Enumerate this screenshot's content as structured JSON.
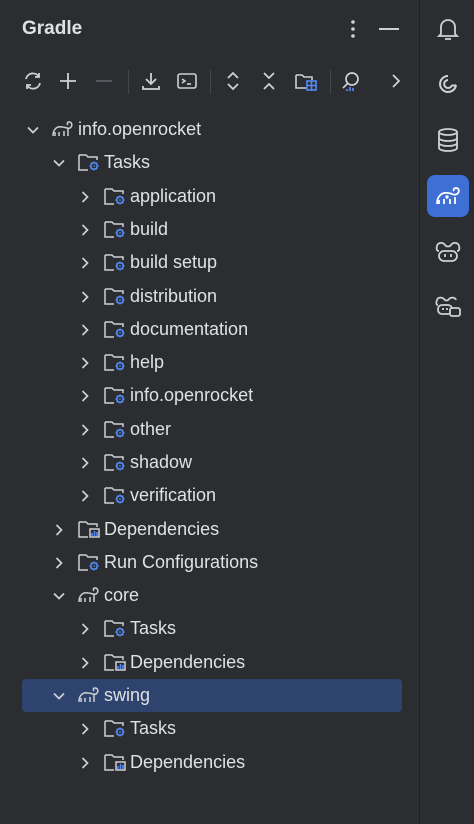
{
  "header": {
    "title": "Gradle"
  },
  "tree": [
    {
      "label": "info.openrocket",
      "icon": "gradle-elephant-icon",
      "expanded": true,
      "level": 0
    },
    {
      "label": "Tasks",
      "icon": "folder-gear-icon",
      "expanded": true,
      "level": 1
    },
    {
      "label": "application",
      "icon": "folder-gear-icon",
      "expanded": false,
      "level": 2
    },
    {
      "label": "build",
      "icon": "folder-gear-icon",
      "expanded": false,
      "level": 2
    },
    {
      "label": "build setup",
      "icon": "folder-gear-icon",
      "expanded": false,
      "level": 2
    },
    {
      "label": "distribution",
      "icon": "folder-gear-icon",
      "expanded": false,
      "level": 2
    },
    {
      "label": "documentation",
      "icon": "folder-gear-icon",
      "expanded": false,
      "level": 2
    },
    {
      "label": "help",
      "icon": "folder-gear-icon",
      "expanded": false,
      "level": 2
    },
    {
      "label": "info.openrocket",
      "icon": "folder-gear-icon",
      "expanded": false,
      "level": 2
    },
    {
      "label": "other",
      "icon": "folder-gear-icon",
      "expanded": false,
      "level": 2
    },
    {
      "label": "shadow",
      "icon": "folder-gear-icon",
      "expanded": false,
      "level": 2
    },
    {
      "label": "verification",
      "icon": "folder-gear-icon",
      "expanded": false,
      "level": 2
    },
    {
      "label": "Dependencies",
      "icon": "folder-chart-icon",
      "expanded": false,
      "level": 1
    },
    {
      "label": "Run Configurations",
      "icon": "folder-gear-icon",
      "expanded": false,
      "level": 1
    },
    {
      "label": "core",
      "icon": "gradle-elephant-icon",
      "expanded": true,
      "level": 1
    },
    {
      "label": "Tasks",
      "icon": "folder-gear-icon",
      "expanded": false,
      "level": 2
    },
    {
      "label": "Dependencies",
      "icon": "folder-chart-icon",
      "expanded": false,
      "level": 2
    },
    {
      "label": "swing",
      "icon": "gradle-elephant-icon",
      "expanded": true,
      "level": 1,
      "selected": true
    },
    {
      "label": "Tasks",
      "icon": "folder-gear-icon",
      "expanded": false,
      "level": 2
    },
    {
      "label": "Dependencies",
      "icon": "folder-chart-icon",
      "expanded": false,
      "level": 2
    }
  ],
  "toolbar_icons": [
    "reload-icon",
    "add-icon",
    "remove-icon",
    "download-sources-icon",
    "execute-task-icon",
    "expand-all-icon",
    "collapse-all-icon",
    "group-modules-icon",
    "analyze-dependencies-icon",
    "more-chevron-icon"
  ],
  "side_icons": [
    "notifications-bell-icon",
    "ai-assistant-icon",
    "database-icon",
    "gradle-icon",
    "copilot-icon",
    "copilot-chat-icon"
  ],
  "colors": {
    "background": "#2b2d30",
    "selection": "#2e436e",
    "accent": "#3d6fd4",
    "text": "#dfe1e5",
    "icon": "#ced0d6",
    "gear": "#548af7"
  }
}
